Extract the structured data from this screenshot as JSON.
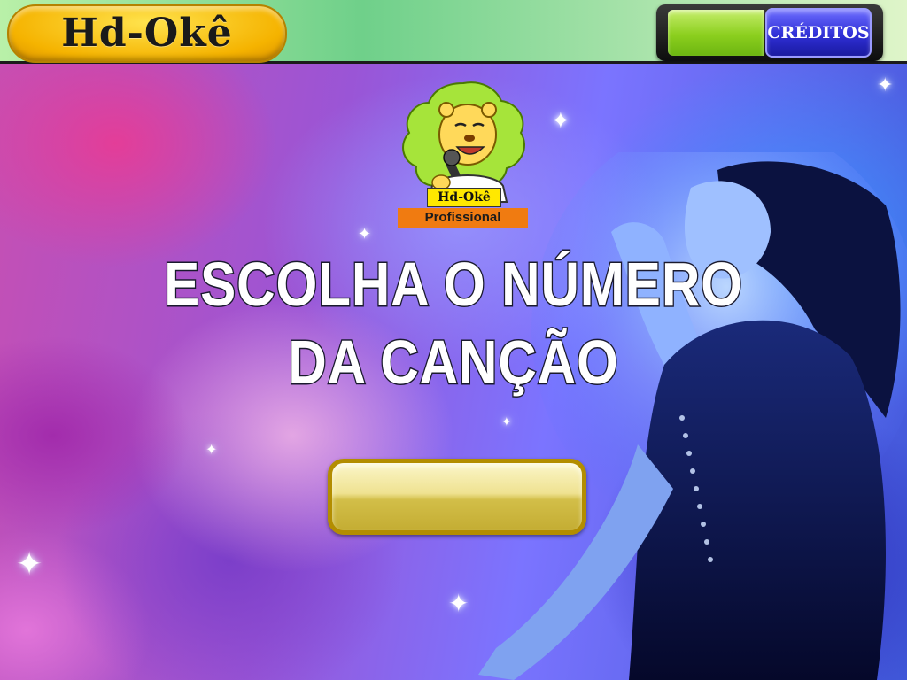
{
  "topbar": {
    "brand": "Hd-Okê",
    "credits_value": "",
    "credits_button_label": "CRÉDITOS"
  },
  "logo": {
    "brand_label": "Hd-Okê",
    "subtitle": "Profissional"
  },
  "heading": {
    "line1": "ESCOLHA O NÚMERO",
    "line2": "DA CANÇÃO"
  },
  "song_input": {
    "value": "",
    "placeholder": ""
  },
  "colors": {
    "brand_yellow": "#f5b300",
    "credit_green": "#8ccf1e",
    "credit_button_blue": "#2f2fd6",
    "input_gold": "#b38d00",
    "logo_orange": "#f07b11"
  },
  "icons": {
    "mascot": "lion-singer-mascot",
    "sparkle": "sparkle-star"
  }
}
